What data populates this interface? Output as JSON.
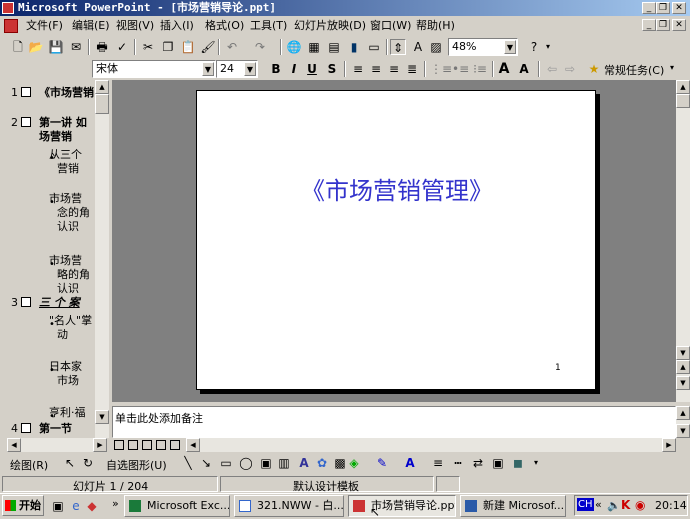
{
  "window": {
    "title": "Microsoft PowerPoint - [市场营销导论.ppt]"
  },
  "menu": [
    "文件(F)",
    "编辑(E)",
    "视图(V)",
    "插入(I)",
    "格式(O)",
    "工具(T)",
    "幻灯片放映(D)",
    "窗口(W)",
    "帮助(H)"
  ],
  "toolbar": {
    "zoom": "48%",
    "font_name": "宋体",
    "font_size": "24",
    "bold": "B",
    "italic": "I",
    "underline": "U",
    "shadow": "S",
    "tasks": "常规任务(C)"
  },
  "outline": [
    {
      "num": "1",
      "title": "《市场营销"
    },
    {
      "num": "2",
      "title": "第一讲  如",
      "title2": "场营销"
    },
    {
      "bullet": "从三个",
      "b2": "营销"
    },
    {
      "bullet": "市场营",
      "b2": "念的角",
      "b3": "认识"
    },
    {
      "bullet": "市场营",
      "b2": "略的角",
      "b3": "认识"
    },
    {
      "num": "3",
      "title": "三 个 案"
    },
    {
      "bullet": "\"名人\"掌",
      "b2": "动"
    },
    {
      "bullet": "日本家",
      "b2": "市场"
    },
    {
      "bullet": "亨利·福"
    },
    {
      "num": "4",
      "title": "第一节  "
    }
  ],
  "slide": {
    "title": "《市场营销管理》",
    "number": "1",
    "title_color": "#3333cc"
  },
  "notes": {
    "placeholder": "单击此处添加备注"
  },
  "drawing": {
    "draw": "绘图(R)",
    "autoshapes": "自选图形(U)"
  },
  "status": {
    "slide": "幻灯片 1 / 204",
    "design": "默认设计模板"
  },
  "taskbar": {
    "start": "开始",
    "tasks": [
      "Microsoft Exc...",
      "321.NWW - 白...",
      "市场营销导论.ppt",
      "新建 Microsof..."
    ],
    "lang": "CH",
    "time": "20:14"
  }
}
